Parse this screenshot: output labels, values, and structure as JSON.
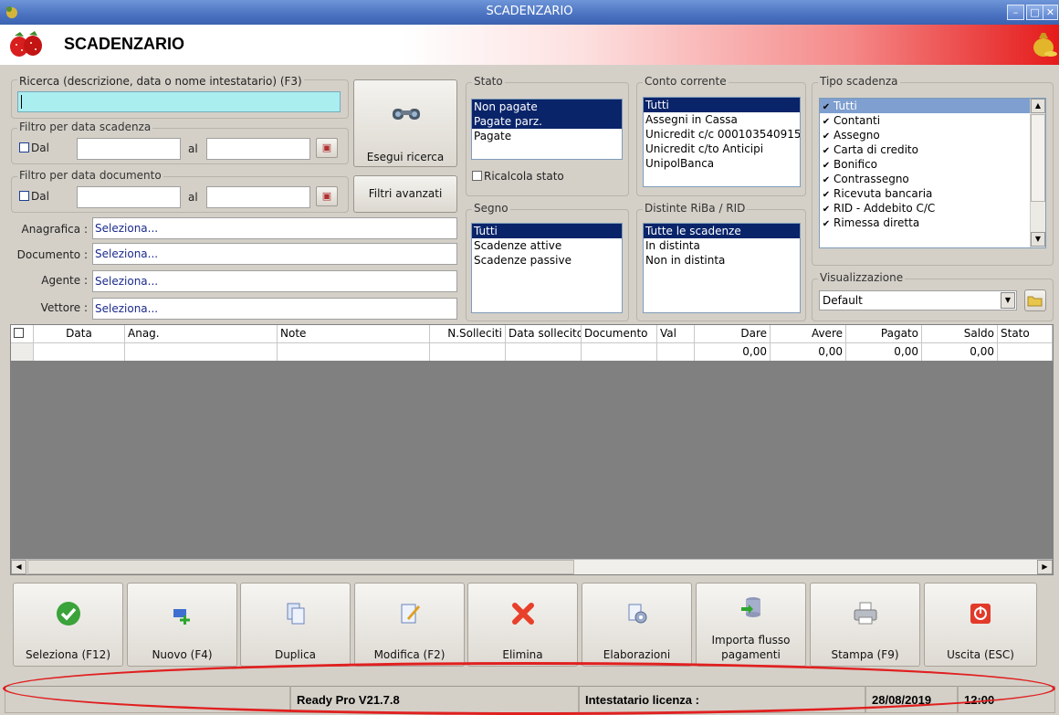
{
  "window": {
    "title": "SCADENZARIO"
  },
  "header": {
    "title": "SCADENZARIO"
  },
  "search": {
    "label": "Ricerca (descrizione, data o nome intestatario) (F3)",
    "value": "",
    "run_button": "Esegui ricerca",
    "advanced_button": "Filtri avanzati"
  },
  "filter_scadenza": {
    "legend": "Filtro per data scadenza",
    "from_label": "Dal",
    "to_label": "al"
  },
  "filter_documento": {
    "legend": "Filtro per data documento",
    "from_label": "Dal",
    "to_label": "al"
  },
  "fields": [
    {
      "label": "Anagrafica :",
      "value": "Seleziona..."
    },
    {
      "label": "Documento :",
      "value": "Seleziona..."
    },
    {
      "label": "Agente :",
      "value": "Seleziona..."
    },
    {
      "label": "Vettore :",
      "value": "Seleziona..."
    }
  ],
  "stato": {
    "legend": "Stato",
    "items": [
      {
        "label": "Non pagate",
        "selected": true
      },
      {
        "label": "Pagate parz.",
        "selected": true
      },
      {
        "label": "Pagate",
        "selected": false
      }
    ],
    "ricalcola": "Ricalcola stato"
  },
  "conto": {
    "legend": "Conto corrente",
    "items": [
      {
        "label": "Tutti",
        "selected": true
      },
      {
        "label": "Assegni in Cassa",
        "selected": false
      },
      {
        "label": "Unicredit c/c 000103540915",
        "selected": false
      },
      {
        "label": "Unicredit c/to Anticipi",
        "selected": false
      },
      {
        "label": "UnipolBanca",
        "selected": false
      }
    ]
  },
  "tipo": {
    "legend": "Tipo scadenza",
    "items": [
      {
        "label": "Tutti",
        "checked": true,
        "selected": true
      },
      {
        "label": "Contanti",
        "checked": true
      },
      {
        "label": "Assegno",
        "checked": true
      },
      {
        "label": "Carta di credito",
        "checked": true
      },
      {
        "label": "Bonifico",
        "checked": true
      },
      {
        "label": "Contrassegno",
        "checked": true
      },
      {
        "label": "Ricevuta bancaria",
        "checked": true
      },
      {
        "label": "RID - Addebito C/C",
        "checked": true
      },
      {
        "label": "Rimessa diretta",
        "checked": true
      }
    ]
  },
  "segno": {
    "legend": "Segno",
    "items": [
      {
        "label": "Tutti",
        "selected": true
      },
      {
        "label": "Scadenze attive",
        "selected": false
      },
      {
        "label": "Scadenze passive",
        "selected": false
      }
    ]
  },
  "distinte": {
    "legend": "Distinte RiBa / RID",
    "items": [
      {
        "label": "Tutte le scadenze",
        "selected": true
      },
      {
        "label": "In distinta",
        "selected": false
      },
      {
        "label": "Non in distinta",
        "selected": false
      }
    ]
  },
  "visualizzazione": {
    "legend": "Visualizzazione",
    "value": "Default"
  },
  "grid": {
    "columns": [
      "Data",
      "Anag.",
      "Note",
      "N.Solleciti",
      "Data sollecito",
      "Documento",
      "Val",
      "Dare",
      "Avere",
      "Pagato",
      "Saldo",
      "Stato"
    ],
    "totals": {
      "dare": "0,00",
      "avere": "0,00",
      "pagato": "0,00",
      "saldo": "0,00"
    }
  },
  "buttons": [
    {
      "label": "Seleziona (F12)",
      "icon": "check-icon"
    },
    {
      "label": "Nuovo (F4)",
      "icon": "new-icon"
    },
    {
      "label": "Duplica",
      "icon": "duplicate-icon"
    },
    {
      "label": "Modifica (F2)",
      "icon": "edit-icon"
    },
    {
      "label": "Elimina",
      "icon": "delete-icon"
    },
    {
      "label": "Elaborazioni",
      "icon": "process-icon"
    },
    {
      "label": "Importa flusso pagamenti",
      "icon": "import-icon"
    },
    {
      "label": "Stampa (F9)",
      "icon": "print-icon"
    },
    {
      "label": "Uscita (ESC)",
      "icon": "exit-icon"
    }
  ],
  "status": {
    "version": "Ready Pro V21.7.8",
    "license": "Intestatario licenza :",
    "date": "28/08/2019",
    "time": "12:00"
  },
  "colors": {
    "selection": "#0a246a",
    "annotation": "#e02020",
    "search_bg": "#aaeef0"
  }
}
